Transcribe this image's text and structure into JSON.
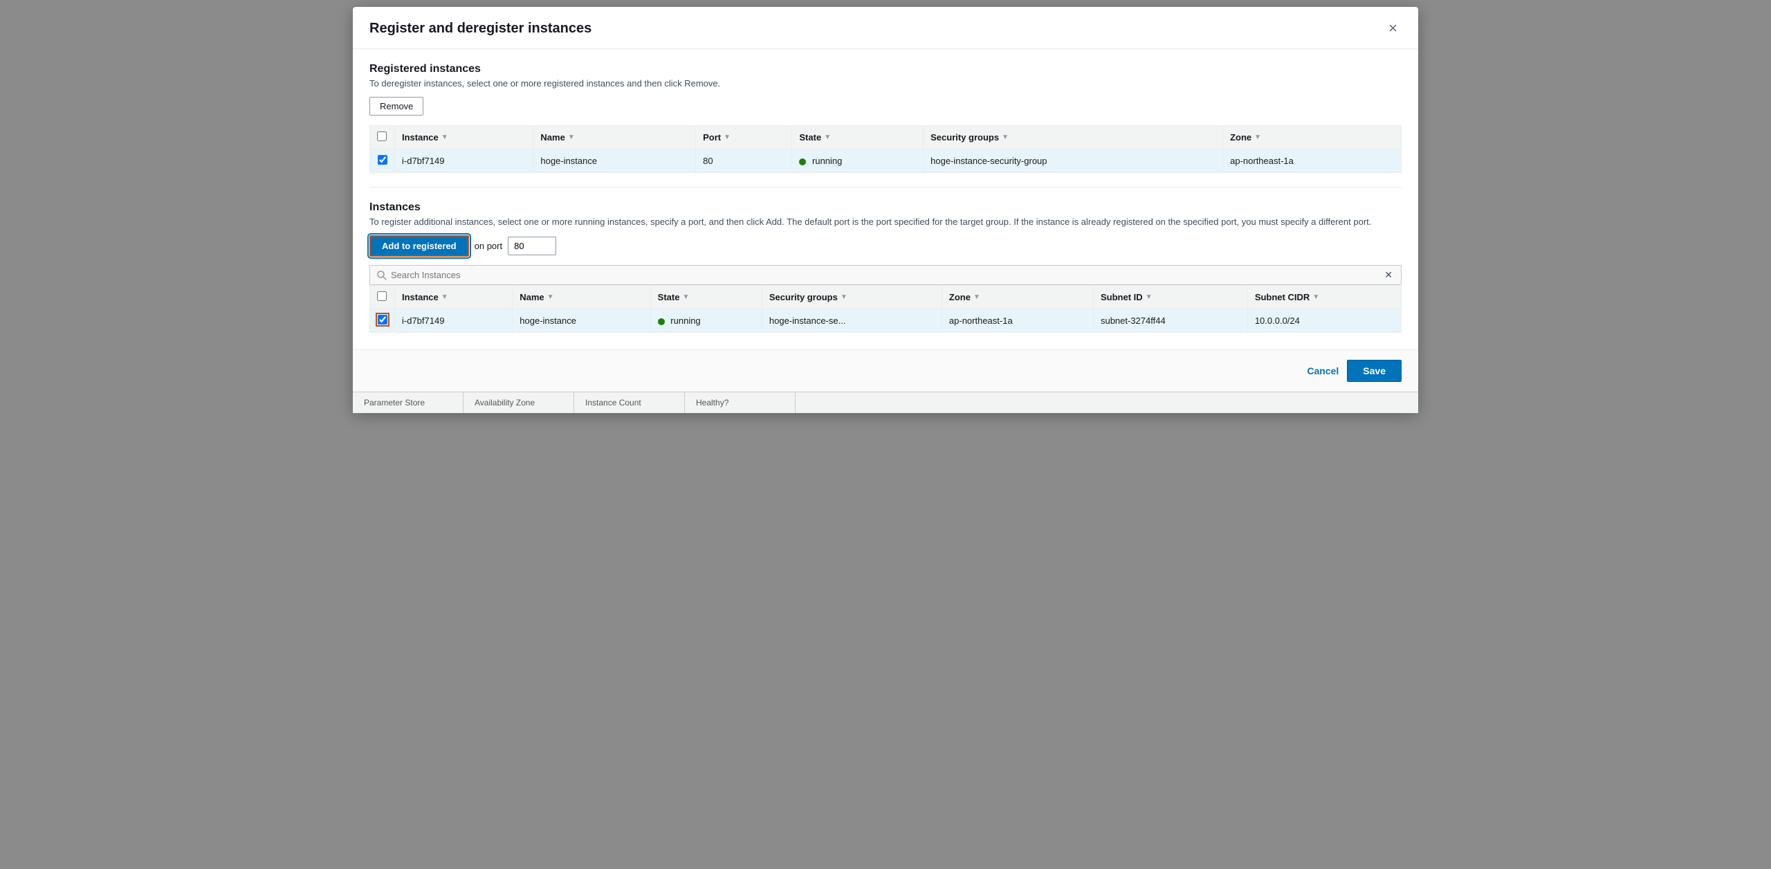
{
  "modal": {
    "title": "Register and deregister instances",
    "close_label": "×"
  },
  "registered_section": {
    "title": "Registered instances",
    "description": "To deregister instances, select one or more registered instances and then click Remove.",
    "remove_button": "Remove",
    "table": {
      "columns": [
        "Instance",
        "Name",
        "Port",
        "State",
        "Security groups",
        "Zone"
      ],
      "rows": [
        {
          "checkbox": true,
          "instance": "i-d7bf7149",
          "name": "hoge-instance",
          "port": "80",
          "state": "running",
          "state_color": "#1d8102",
          "security_groups": "hoge-instance-security-group",
          "zone": "ap-northeast-1a"
        }
      ]
    }
  },
  "instances_section": {
    "title": "Instances",
    "description": "To register additional instances, select one or more running instances, specify a port, and then click Add. The default port is the port specified for the target group. If the instance is already registered on the specified port, you must specify a different port.",
    "add_button": "Add to registered",
    "on_port_label": "on port",
    "port_value": "80",
    "search_placeholder": "Search Instances",
    "table": {
      "columns": [
        "Instance",
        "Name",
        "State",
        "Security groups",
        "Zone",
        "Subnet ID",
        "Subnet CIDR"
      ],
      "rows": [
        {
          "checkbox": true,
          "checkbox_selected": true,
          "instance": "i-d7bf7149",
          "name": "hoge-instance",
          "state": "running",
          "state_color": "#1d8102",
          "security_groups": "hoge-instance-se...",
          "zone": "ap-northeast-1a",
          "subnet_id": "subnet-3274ff44",
          "subnet_cidr": "10.0.0.0/24"
        }
      ]
    }
  },
  "footer": {
    "cancel_label": "Cancel",
    "save_label": "Save"
  },
  "bottom_bar": {
    "items": [
      "Parameter Store",
      "Availability Zone",
      "Instance Count",
      "Healthy?"
    ]
  }
}
